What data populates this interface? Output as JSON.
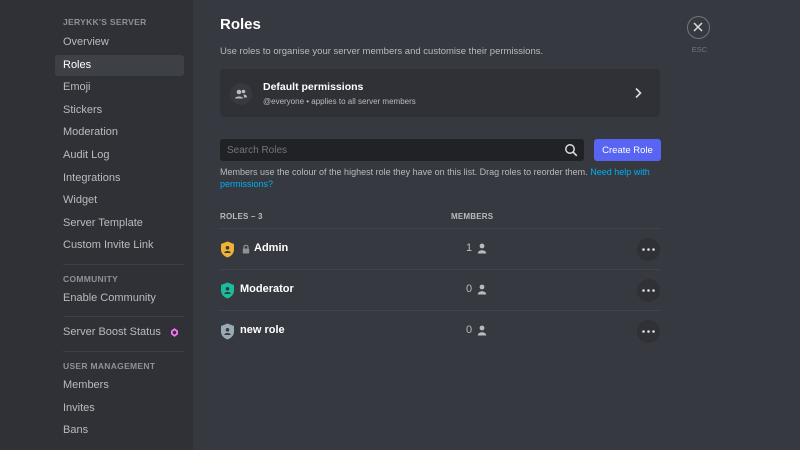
{
  "sidebar": {
    "server_name": "JERYKK'S SERVER",
    "items": [
      {
        "label": "Overview"
      },
      {
        "label": "Roles"
      },
      {
        "label": "Emoji"
      },
      {
        "label": "Stickers"
      },
      {
        "label": "Moderation"
      },
      {
        "label": "Audit Log"
      },
      {
        "label": "Integrations"
      },
      {
        "label": "Widget"
      },
      {
        "label": "Server Template"
      },
      {
        "label": "Custom Invite Link"
      }
    ],
    "selected": "Roles",
    "community_heading": "COMMUNITY",
    "community_items": [
      {
        "label": "Enable Community"
      }
    ],
    "boost_item": {
      "label": "Server Boost Status"
    },
    "user_management_heading": "USER MANAGEMENT",
    "user_management_items": [
      {
        "label": "Members"
      },
      {
        "label": "Invites"
      },
      {
        "label": "Bans"
      }
    ]
  },
  "main": {
    "title": "Roles",
    "description": "Use roles to organise your server members and customise their permissions.",
    "default_permissions": {
      "title": "Default permissions",
      "subtitle": "@everyone • applies to all server members",
      "icon": "people-icon"
    },
    "search": {
      "placeholder": "Search Roles",
      "value": ""
    },
    "create_role_label": "Create Role",
    "help": {
      "text": "Members use the colour of the highest role they have on this list. Drag roles to reorder them.",
      "link_text": "Need help with permissions?"
    },
    "columns": {
      "roles": "ROLES – 3",
      "members": "MEMBERS"
    },
    "roles": [
      {
        "name": "Admin",
        "members": "1",
        "color": "#f0b232",
        "locked": true
      },
      {
        "name": "Moderator",
        "members": "0",
        "color": "#1abc9c",
        "locked": false
      },
      {
        "name": "new role",
        "members": "0",
        "color": "#99aab5",
        "locked": false
      }
    ]
  },
  "close": {
    "label": "ESC",
    "icon": "close-icon"
  },
  "colors": {
    "accent": "#5865f2",
    "link": "#00aff4",
    "sidebar_bg": "#2f3136",
    "main_bg": "#36393f",
    "boost": "#ff73fa"
  }
}
